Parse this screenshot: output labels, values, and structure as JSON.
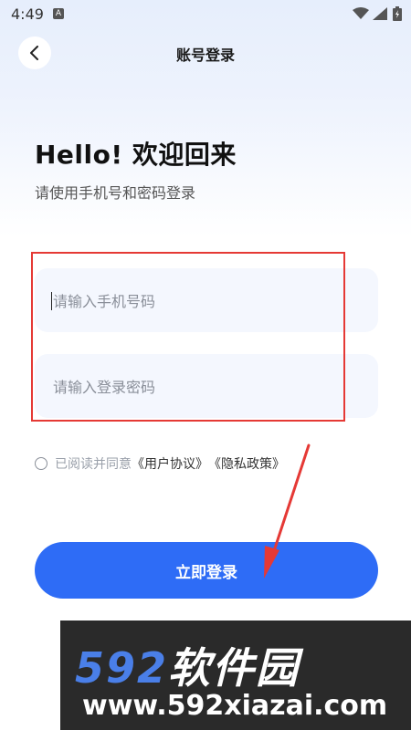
{
  "status_bar": {
    "time": "4:49",
    "notif_badge": "A"
  },
  "header": {
    "title": "账号登录"
  },
  "welcome": {
    "heading": "Hello! 欢迎回来",
    "subheading": "请使用手机号和密码登录"
  },
  "form": {
    "phone_placeholder": "请输入手机号码",
    "password_placeholder": "请输入登录密码"
  },
  "agreement": {
    "prefix": "已阅读并同意",
    "user_agreement": "《用户协议》",
    "privacy_policy": "《隐私政策》"
  },
  "login_button": {
    "label": "立即登录"
  },
  "watermark": {
    "number": "592",
    "brand": "软件园",
    "url": "www.592xiazai.com"
  },
  "colors": {
    "accent": "#2e6cf6",
    "annotation": "#e53935"
  }
}
